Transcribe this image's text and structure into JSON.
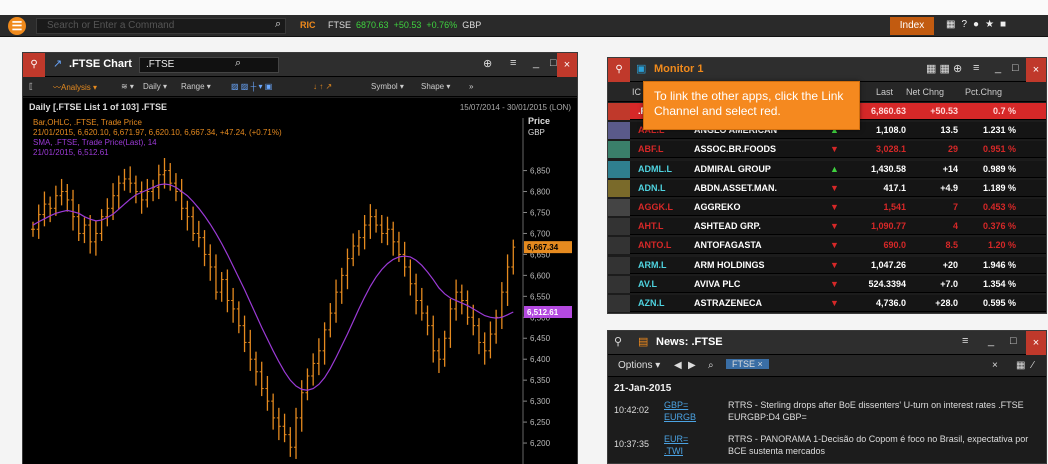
{
  "topbar": {
    "search_placeholder": "Search or Enter a Command",
    "rc_label": "RIC",
    "ticker_symbol": "FTSE",
    "ticker_value": "6870.63",
    "ticker_change": "+50.53",
    "ticker_pct": "+0.76%",
    "ticker_ccy": "GBP",
    "index_button": "Index"
  },
  "chart": {
    "title": ".FTSE Chart",
    "symbol": ".FTSE",
    "toolbar": {
      "analysis": "Analysis",
      "daily": "Daily",
      "range": "Range",
      "symbol": "Symbol",
      "shape": "Shape"
    },
    "subtitle": "Daily [.FTSE List 1 of 103] .FTSE",
    "date_range": "15/07/2014 - 30/01/2015 (LON)",
    "legend1_title": "Bar,OHLC, .FTSE, Trade Price",
    "legend1_values": "21/01/2015, 6,620.10, 6,671.97, 6,620.10, 6,667.34, +47.24, (+0.71%)",
    "legend2_title": "SMA, .FTSE, Trade Price(Last), 14",
    "legend2_values": "21/01/2015, 6,512.61",
    "price_label": "Price",
    "ccy_label": "GBP",
    "last_price_tag": "6,667.34",
    "sma_tag": "6,512.61"
  },
  "chart_data": {
    "type": "line",
    "ylabel": "Price GBP",
    "y_ticks": [
      6200,
      6250,
      6300,
      6350,
      6400,
      6450,
      6500,
      6550,
      6600,
      6650,
      6700,
      6750,
      6800,
      6850
    ],
    "ylim": [
      6150,
      6880
    ],
    "series": [
      {
        "name": "Bar,OHLC, .FTSE, Trade Price",
        "color": "#e58a1f",
        "values": [
          6710,
          6745,
          6770,
          6760,
          6790,
          6800,
          6780,
          6740,
          6700,
          6720,
          6680,
          6700,
          6740,
          6760,
          6790,
          6820,
          6830,
          6820,
          6800,
          6780,
          6800,
          6810,
          6840,
          6850,
          6820,
          6800,
          6760,
          6740,
          6700,
          6690,
          6650,
          6620,
          6560,
          6590,
          6540,
          6520,
          6480,
          6440,
          6400,
          6370,
          6330,
          6300,
          6260,
          6240,
          6220,
          6190,
          6260,
          6320,
          6360,
          6390,
          6420,
          6470,
          6510,
          6560,
          6600,
          6640,
          6670,
          6690,
          6720,
          6740,
          6720,
          6700,
          6710,
          6680,
          6650,
          6620,
          6580,
          6540,
          6510,
          6480,
          6420,
          6400,
          6450,
          6520,
          6560,
          6540,
          6500,
          6480,
          6440,
          6420,
          6460,
          6500,
          6560,
          6620,
          6667.34
        ]
      },
      {
        "name": "SMA, .FTSE, Trade Price(Last), 14",
        "color": "#9b3ad6",
        "values": [
          6720,
          6728,
          6735,
          6742,
          6748,
          6752,
          6755,
          6752,
          6748,
          6740,
          6734,
          6730,
          6732,
          6738,
          6746,
          6758,
          6770,
          6782,
          6792,
          6798,
          6804,
          6810,
          6816,
          6818,
          6816,
          6810,
          6800,
          6790,
          6776,
          6760,
          6742,
          6722,
          6700,
          6676,
          6650,
          6622,
          6594,
          6566,
          6536,
          6506,
          6476,
          6448,
          6420,
          6394,
          6370,
          6350,
          6336,
          6328,
          6326,
          6330,
          6340,
          6356,
          6378,
          6404,
          6432,
          6460,
          6490,
          6520,
          6548,
          6574,
          6596,
          6614,
          6628,
          6638,
          6644,
          6646,
          6644,
          6636,
          6624,
          6608,
          6590,
          6570,
          6556,
          6546,
          6540,
          6534,
          6528,
          6520,
          6512,
          6504,
          6500,
          6498,
          6500,
          6506,
          6512.61
        ]
      }
    ]
  },
  "monitor": {
    "title": "Monitor 1",
    "headers": {
      "ric": "IC",
      "last": "Last",
      "net": "Net Chng",
      "pct": "Pct.Chng"
    },
    "tooltip": "To link the other apps, click the Link Channel and select red.",
    "rows": [
      {
        "ric": ".F",
        "name": "",
        "dir": "",
        "last": "6,860.63",
        "net": "+50.53",
        "pct": "0.7 %",
        "highlight": true
      },
      {
        "ric": "AAL.L",
        "name": "ANGLO AMERICAN",
        "dir": "up",
        "last": "1,108.0",
        "net": "13.5",
        "pct": "1.231 %"
      },
      {
        "ric": "ABF.L",
        "name": "ASSOC.BR.FOODS",
        "dir": "down",
        "last": "3,028.1",
        "net": "29",
        "pct": "0.951 %"
      },
      {
        "ric": "ADML.L",
        "name": "ADMIRAL GROUP",
        "dir": "up",
        "last": "1,430.58",
        "net": "+14",
        "pct": "0.989 %"
      },
      {
        "ric": "ADN.L",
        "name": "ABDN.ASSET.MAN.",
        "dir": "down",
        "last": "417.1",
        "net": "+4.9",
        "pct": "1.189 %"
      },
      {
        "ric": "AGGK.L",
        "name": "AGGREKO",
        "dir": "down",
        "last": "1,541",
        "net": "7",
        "pct": "0.453 %"
      },
      {
        "ric": "AHT.L",
        "name": "ASHTEAD GRP.",
        "dir": "down",
        "last": "1,090.77",
        "net": "4",
        "pct": "0.376 %"
      },
      {
        "ric": "ANTO.L",
        "name": "ANTOFAGASTA",
        "dir": "down",
        "last": "690.0",
        "net": "8.5",
        "pct": "1.20 %"
      },
      {
        "ric": "ARM.L",
        "name": "ARM HOLDINGS",
        "dir": "down",
        "last": "1,047.26",
        "net": "+20",
        "pct": "1.946 %"
      },
      {
        "ric": "AV.L",
        "name": "AVIVA PLC",
        "dir": "down",
        "last": "524.3394",
        "net": "+7.0",
        "pct": "1.354 %"
      },
      {
        "ric": "AZN.L",
        "name": "ASTRAZENECA",
        "dir": "down",
        "last": "4,736.0",
        "net": "+28.0",
        "pct": "0.595 %"
      }
    ]
  },
  "news": {
    "title": "News: .FTSE",
    "options_label": "Options",
    "filter_chip": "FTSE",
    "date": "21-Jan-2015",
    "items": [
      {
        "time": "10:42:02",
        "ric1": "GBP=",
        "ric2": "EURGB",
        "headline": "RTRS - Sterling drops after BoE dissenters' U-turn on interest rates .FTSE EURGBP:D4 GBP="
      },
      {
        "time": "10:37:35",
        "ric1": "EUR=",
        "ric2": ".TWI",
        "headline": "RTRS - PANORAMA 1-Decisão do Copom é foco no Brasil, expectativa por BCE sustenta mercados"
      }
    ]
  }
}
